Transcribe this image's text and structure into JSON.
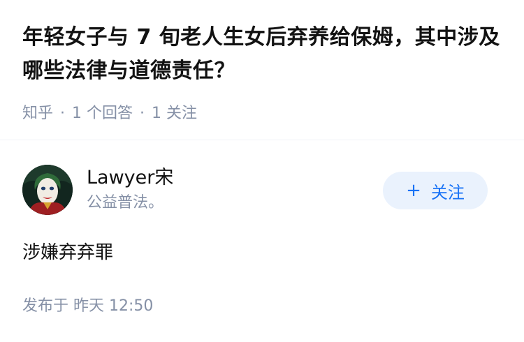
{
  "question": {
    "title": "年轻女子与 7 旬老人生女后弃养给保姆，其中涉及哪些法律与道德责任？",
    "source": "知乎",
    "separator": "·",
    "answer_count": "1 个回答",
    "follow_count": "1 关注"
  },
  "answer": {
    "author": {
      "name": "Lawyer宋",
      "bio": "公益普法。",
      "avatar_icon": "joker-portrait-avatar"
    },
    "follow_button": {
      "icon": "plus-icon",
      "icon_glyph": "+",
      "label": "关注",
      "color": "#1772f6",
      "background": "#eaf2fd"
    },
    "content": "涉嫌弃弃罪",
    "published": "发布于  昨天 12:50"
  },
  "colors": {
    "text_primary": "#121212",
    "text_secondary": "#8590a6",
    "divider": "#f0f2f7"
  }
}
